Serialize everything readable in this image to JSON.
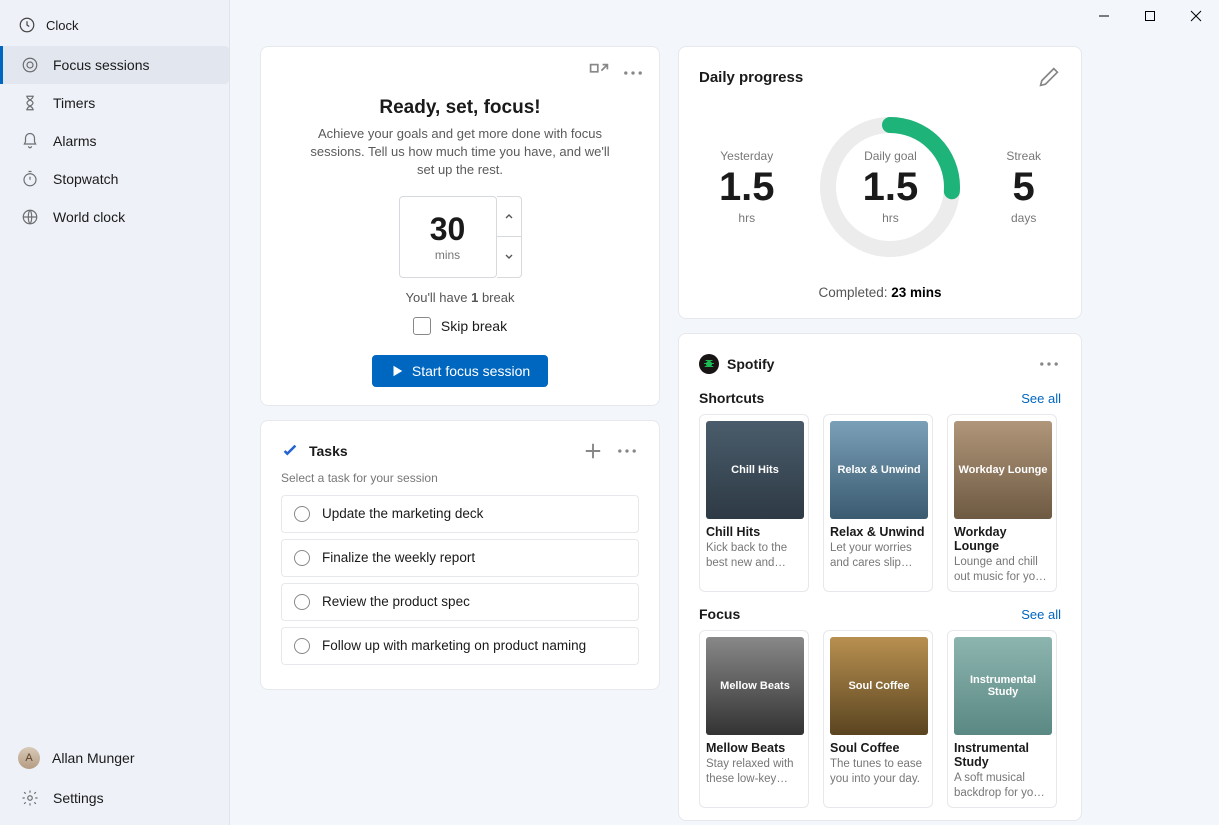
{
  "app": {
    "title": "Clock"
  },
  "nav": {
    "items": [
      {
        "label": "Focus sessions"
      },
      {
        "label": "Timers"
      },
      {
        "label": "Alarms"
      },
      {
        "label": "Stopwatch"
      },
      {
        "label": "World clock"
      }
    ]
  },
  "user": {
    "name": "Allan Munger",
    "initials": "A"
  },
  "settings_label": "Settings",
  "focus": {
    "heading": "Ready, set, focus!",
    "subtext": "Achieve your goals and get more done with focus sessions. Tell us how much time you have, and we'll set up the rest.",
    "minutes": "30",
    "minutes_unit": "mins",
    "break_text_pre": "You'll have ",
    "break_count": "1",
    "break_text_post": " break",
    "skip_label": "Skip break",
    "start_label": "Start focus session"
  },
  "tasks": {
    "title": "Tasks",
    "subtext": "Select a task for your session",
    "items": [
      {
        "label": "Update the marketing deck"
      },
      {
        "label": "Finalize the weekly report"
      },
      {
        "label": "Review the product spec"
      },
      {
        "label": "Follow up with marketing on product naming"
      }
    ]
  },
  "progress": {
    "title": "Daily progress",
    "yesterday_label": "Yesterday",
    "yesterday_val": "1.5",
    "yesterday_unit": "hrs",
    "goal_label": "Daily goal",
    "goal_val": "1.5",
    "goal_unit": "hrs",
    "streak_label": "Streak",
    "streak_val": "5",
    "streak_unit": "days",
    "completed_label": "Completed: ",
    "completed_val": "23 mins",
    "ring_percent": 26
  },
  "spotify": {
    "brand": "Spotify",
    "see_all": "See all",
    "sections": [
      {
        "title": "Shortcuts",
        "items": [
          {
            "name": "Chill Hits",
            "img_label": "Chill Hits",
            "desc": "Kick back to the best new and rece…"
          },
          {
            "name": "Relax & Unwind",
            "img_label": "Relax & Unwind",
            "desc": "Let your worries and cares slip away."
          },
          {
            "name": "Workday Lounge",
            "img_label": "Workday Lounge",
            "desc": "Lounge and chill out music for your wor…"
          }
        ]
      },
      {
        "title": "Focus",
        "items": [
          {
            "name": "Mellow  Beats",
            "img_label": "Mellow Beats",
            "desc": "Stay relaxed with these low-key beat…"
          },
          {
            "name": "Soul Coffee",
            "img_label": "Soul Coffee",
            "desc": "The tunes to ease you into your day."
          },
          {
            "name": "Instrumental Study",
            "img_label": "Instrumental Study",
            "desc": "A soft musical backdrop for your …"
          }
        ]
      }
    ]
  }
}
